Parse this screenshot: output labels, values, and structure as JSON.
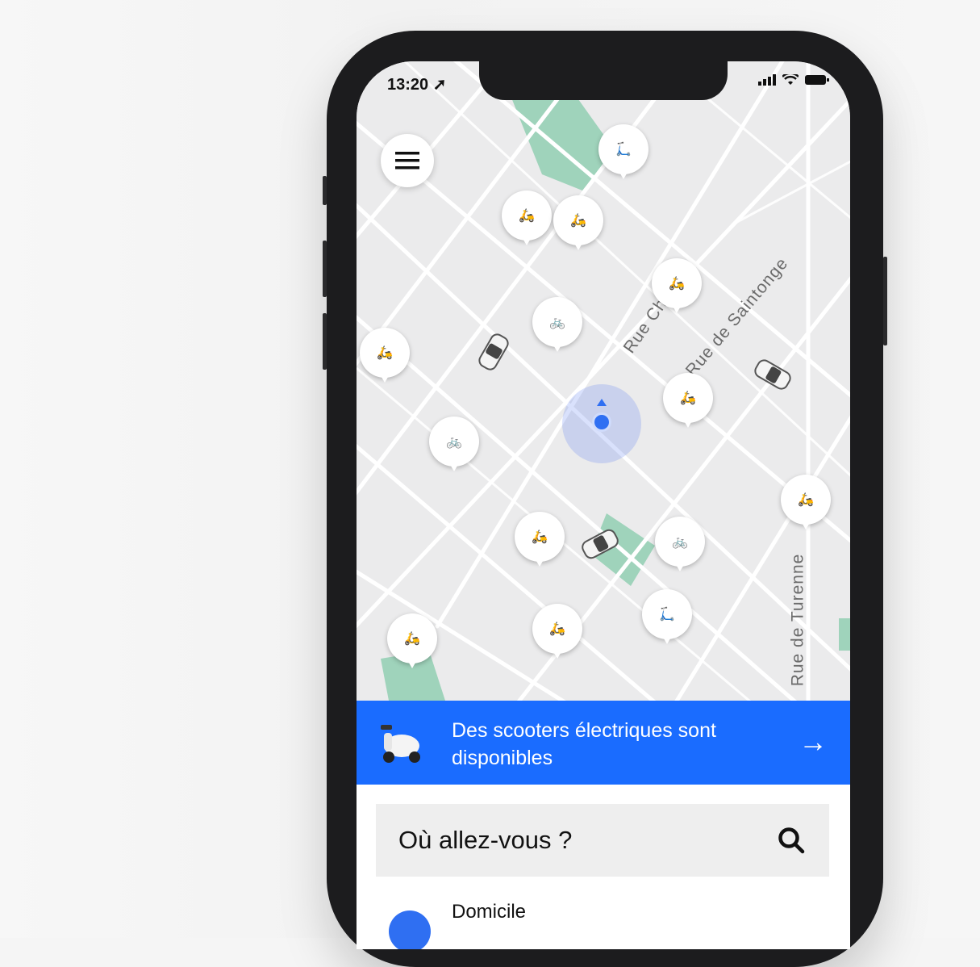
{
  "status_bar": {
    "time": "13:20"
  },
  "map": {
    "streets": [
      "Rue Ch",
      "Rue de Saintonge",
      "Rue de Turenne"
    ],
    "pins": [
      "scooter-icon",
      "scooter-icon",
      "kick-scooter-icon",
      "bike-icon",
      "scooter-icon",
      "scooter-icon",
      "bike-icon",
      "scooter-icon",
      "scooter-icon",
      "bike-icon",
      "scooter-icon",
      "scooter-icon",
      "kick-scooter-icon",
      "scooter-icon"
    ]
  },
  "banner": {
    "text": "Des scooters électriques sont disponibles",
    "arrow": "→"
  },
  "search": {
    "label": "Où allez-vous ?"
  },
  "saved_place": {
    "label": "Domicile"
  },
  "colors": {
    "accent": "#1a6cff",
    "park": "#9fd3bb",
    "road": "#ffffff",
    "map_bg": "#ebebec"
  }
}
